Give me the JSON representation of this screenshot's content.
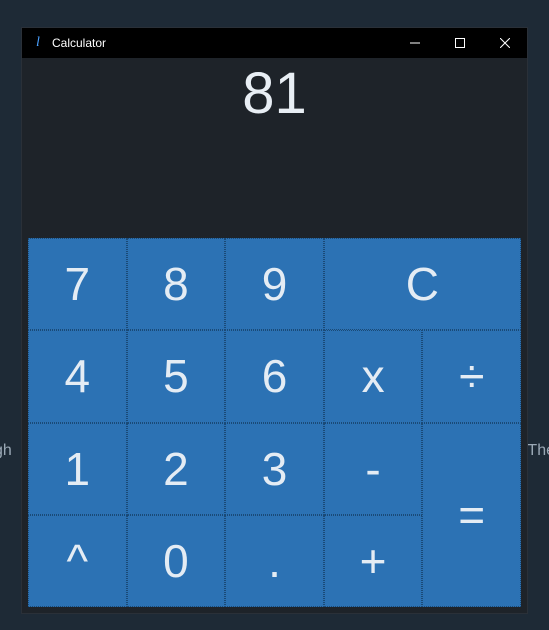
{
  "background": {
    "left_fragment": "gh",
    "right_fragment": "The"
  },
  "window": {
    "title": "Calculator",
    "icon_glyph": "l"
  },
  "display": {
    "value": "81"
  },
  "keys": {
    "k7": "7",
    "k8": "8",
    "k9": "9",
    "kC": "C",
    "k4": "4",
    "k5": "5",
    "k6": "6",
    "kmul": "x",
    "kdiv": "÷",
    "k1": "1",
    "k2": "2",
    "k3": "3",
    "ksub": "-",
    "keq": "=",
    "kpow": "^",
    "k0": "0",
    "kdot": ".",
    "kadd": "+"
  }
}
